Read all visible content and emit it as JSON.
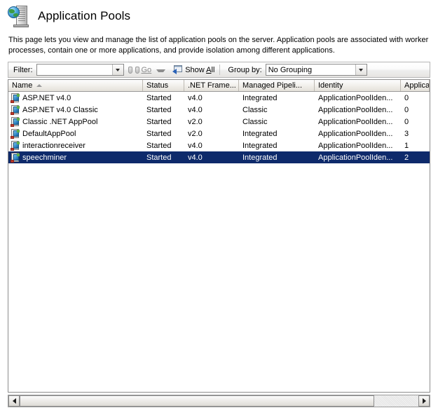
{
  "header": {
    "icon": "server-globe-icon",
    "title": "Application Pools"
  },
  "description": "This page lets you view and manage the list of application pools on the server. Application pools are associated with worker processes, contain one or more applications, and provide isolation among different applications.",
  "toolbar": {
    "filter_label": "Filter:",
    "filter_value": "",
    "filter_placeholder": "",
    "go_label": "Go",
    "go_icon": "binoculars-icon",
    "show_all_label_prefix": "Show ",
    "show_all_label_accel": "A",
    "show_all_label_suffix": "ll",
    "show_all_icon": "show-all-window-icon",
    "group_by_label": "Group by:",
    "group_by_value": "No Grouping"
  },
  "grid": {
    "columns": [
      {
        "label": "Name",
        "sorted": "asc"
      },
      {
        "label": "Status",
        "sorted": ""
      },
      {
        "label": ".NET Frame...",
        "sorted": ""
      },
      {
        "label": "Managed Pipeli...",
        "sorted": ""
      },
      {
        "label": "Identity",
        "sorted": ""
      },
      {
        "label": "Application",
        "sorted": ""
      }
    ],
    "rows": [
      {
        "name": "ASP.NET v4.0",
        "status": "Started",
        "net_framework": "v4.0",
        "managed_pipeline": "Integrated",
        "identity": "ApplicationPoolIden...",
        "applications": "0",
        "selected": false
      },
      {
        "name": "ASP.NET v4.0 Classic",
        "status": "Started",
        "net_framework": "v4.0",
        "managed_pipeline": "Classic",
        "identity": "ApplicationPoolIden...",
        "applications": "0",
        "selected": false
      },
      {
        "name": "Classic .NET AppPool",
        "status": "Started",
        "net_framework": "v2.0",
        "managed_pipeline": "Classic",
        "identity": "ApplicationPoolIden...",
        "applications": "0",
        "selected": false
      },
      {
        "name": "DefaultAppPool",
        "status": "Started",
        "net_framework": "v2.0",
        "managed_pipeline": "Integrated",
        "identity": "ApplicationPoolIden...",
        "applications": "3",
        "selected": false
      },
      {
        "name": "interactionreceiver",
        "status": "Started",
        "net_framework": "v4.0",
        "managed_pipeline": "Integrated",
        "identity": "ApplicationPoolIden...",
        "applications": "1",
        "selected": false
      },
      {
        "name": "speechminer",
        "status": "Started",
        "net_framework": "v4.0",
        "managed_pipeline": "Integrated",
        "identity": "ApplicationPoolIden...",
        "applications": "2",
        "selected": true
      }
    ]
  },
  "colors": {
    "selection": "#0e2a6b",
    "selection_text": "#ffffff",
    "header_gradient_top": "#fdfdfd",
    "header_gradient_bottom": "#e2dfd8",
    "grid_border": "#8d8d8d"
  }
}
